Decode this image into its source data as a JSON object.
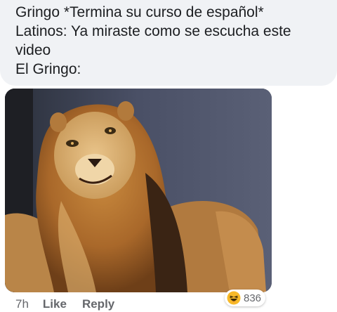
{
  "comment": {
    "lines": [
      "Gringo *Termina su curso de español*",
      "Latinos: Ya miraste como se escucha este",
      "video",
      "El Gringo:"
    ]
  },
  "reactions": {
    "icon": "haha-emoji-icon",
    "count": "836",
    "icon_color": "#f7b928"
  },
  "actions": {
    "timestamp": "7h",
    "like_label": "Like",
    "reply_label": "Reply"
  },
  "colors": {
    "bubble_bg": "#f0f2f5",
    "text": "#1c1e21",
    "meta_text": "#65676b"
  }
}
